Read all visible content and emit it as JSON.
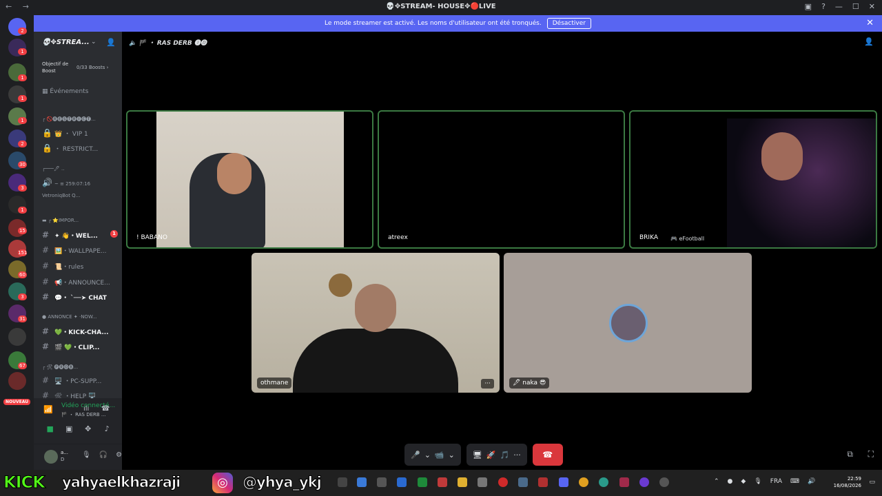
{
  "titlebar": {
    "nav": "← →",
    "title": "💀✥STREAM- HOUSE✥🔴LIVE",
    "inbox_icon": "inbox-icon",
    "help_icon": "help-icon",
    "minimize": "—",
    "maximize": "☐",
    "close": "✕"
  },
  "banner": {
    "text": "Le mode streamer est activé. Les noms d'utilisateur ont été tronqués.",
    "button": "Désactiver",
    "close": "✕"
  },
  "servers": {
    "badges": [
      "2",
      "1",
      "1",
      "1",
      "1",
      "1",
      "2",
      "30",
      "3",
      "1",
      "15",
      "151",
      "60",
      "3",
      "31",
      "67"
    ],
    "new_label": "NOUVEAU"
  },
  "guild": {
    "name": "💀✥STREA...",
    "chevron": "⌄",
    "boost_label": "Objectif de Boost",
    "boost_count": "0/33 Boosts ›",
    "events": "Événements"
  },
  "channels": [
    {
      "hash": "",
      "text": "┌ 🚫🅡🅔🅢🅣🅡🅘🅒🅣...",
      "cat": true
    },
    {
      "hash": "🔒",
      "text": "👑 ・ VIP 1"
    },
    {
      "hash": "🔒",
      "text": "・ RESTRICT..."
    },
    {
      "hash": "",
      "text": "┌───🖊 ..",
      "cat": true
    },
    {
      "hash": "🔊",
      "text": "~ ≡            259:07:16"
    },
    {
      "hash": "",
      "text": "     VetroniqBot Q..."
    },
    {
      "hash": "",
      "text": "▬ ┌ ⭐IMPOR...",
      "cat": true
    },
    {
      "hash": "#",
      "text": "✦ 👋・WEL...",
      "bright": true,
      "badge": "1"
    },
    {
      "hash": "#",
      "text": "🖼️・WALLPAPE..."
    },
    {
      "hash": "#",
      "text": "📜・rules"
    },
    {
      "hash": "#",
      "text": "📢・ANNOUNCE..."
    },
    {
      "hash": "#",
      "text": "💬・ ˋ──➤ CHAT",
      "bright": true
    },
    {
      "hash": "",
      "text": "● ANNONCE ✦ ·NOW...",
      "cat": true
    },
    {
      "hash": "#",
      "text": "💚・KICK-CHA...",
      "bright": true
    },
    {
      "hash": "#",
      "text": "🎬 💚・CLIP...",
      "bright": true
    },
    {
      "hash": "",
      "text": "┌ 🛠 🅟🅡🅞🅑...",
      "cat": true
    },
    {
      "hash": "#",
      "text": "🖥️ ・PC-SUPP..."
    },
    {
      "hash": "#",
      "text": "🛠 ・HELP 🖥️"
    }
  ],
  "voice_connected": {
    "title": "Vidéo connecté...",
    "subtitle": "🏴 ・ RAS DERB ..."
  },
  "user": {
    "name": "a...",
    "status": "D"
  },
  "call": {
    "channel": "🏴 ・ RAS DERB 🅘🅓",
    "participants": [
      {
        "name": "! BABANO"
      },
      {
        "name": "atreex"
      },
      {
        "name": "BRIKA",
        "activity": "🎮 eFootball"
      },
      {
        "name": "othmane",
        "more": "···"
      },
      {
        "name": "🖋 naka 😎"
      }
    ]
  },
  "controls": {
    "mic": "🎤",
    "mic_chev": "⌄",
    "cam": "📹",
    "cam_chev": "⌄",
    "screen": "🖥",
    "activity": "🚀",
    "soundboard": "🎵",
    "more": "···",
    "hangup": "☎"
  },
  "overlay": {
    "kick_label": "KICK",
    "kick_user": "yahyaelkhazraji",
    "ig_user": "@yhya_ykj"
  },
  "taskbar": {
    "lang": "FRA",
    "time": "22:59",
    "date": "16/08/2026"
  }
}
